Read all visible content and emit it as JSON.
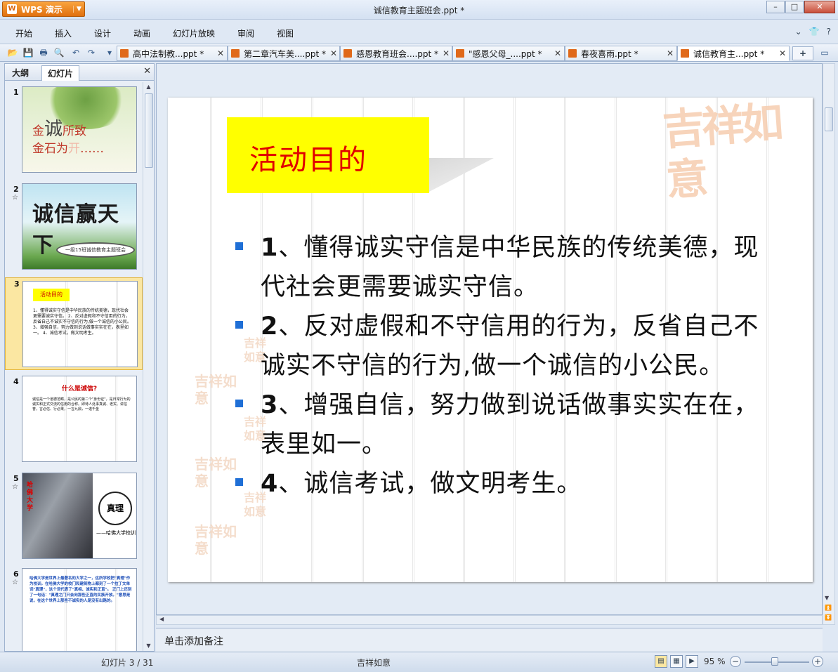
{
  "app": {
    "button_label": "WPS 演示",
    "logo_glyph": "W",
    "document_title": "诚信教育主题班会.ppt *"
  },
  "window_controls": {
    "minimize": "–",
    "maximize": "□",
    "close": "✕"
  },
  "menu": {
    "items": [
      "开始",
      "插入",
      "设计",
      "动画",
      "幻灯片放映",
      "审阅",
      "视图"
    ],
    "right_icons": [
      "⌄",
      "👕",
      "?"
    ]
  },
  "toolbar": {
    "icons": [
      "open-icon",
      "save-icon",
      "print-icon",
      "print-preview-icon",
      "undo-icon",
      "redo-icon",
      "customize-icon"
    ],
    "tabs": [
      {
        "label": "高中法制教...ppt *"
      },
      {
        "label": "第二章汽车美....ppt *"
      },
      {
        "label": "感恩教育班会....ppt *"
      },
      {
        "label": "\"感恩父母_....ppt *"
      },
      {
        "label": "春夜喜雨.ppt *"
      },
      {
        "label": "诚信教育主...ppt *",
        "active": true
      }
    ],
    "tab_close": "✕",
    "add_tab": "+"
  },
  "left_panel": {
    "tabs": [
      "大纲",
      "幻灯片"
    ],
    "active_tab": "幻灯片",
    "close": "✕",
    "thumbnails": [
      {
        "num": "1",
        "star": "",
        "text_a": "金",
        "text_b": "诚",
        "text_c": "所致",
        "text_d": "金石为",
        "text_e": "开",
        "text_f": "……"
      },
      {
        "num": "2",
        "star": "☆",
        "calligraphy": "诚信赢天下",
        "oval": "一级15班诚信教育主题班会"
      },
      {
        "num": "3",
        "star": "",
        "title": "活动目的",
        "body": "1、懂得诚实守信是中华民族的传统美德，现代社会更需要诚实守信。 2、反对虚假和不守信用的行为，反省自己不诚实不守信的行为,做一个诚信的小公民。 3、增强自信，努力做到说话做事实实在在，表里如一。 4、诚信考试，做文明考生。"
      },
      {
        "num": "4",
        "star": "",
        "title": "什么是诚信?",
        "body": "诚信是一个道德范畴，是公民的第二个\"身份证\"，是日常行为的诚实和正式交流的信用的合称。即待人处事真诚、老实、讲信誉，言必信、行必果，一言九鼎，一诺千金"
      },
      {
        "num": "5",
        "star": "☆",
        "red": "哈佛大学",
        "circle": "真理",
        "sub": "——哈佛大学校训"
      },
      {
        "num": "6",
        "star": "☆",
        "body": "哈佛大学是世界上最著名的大学之一，这所学校把\"真理\"作为校训。在哈佛大学的校门和建筑物上都刻了一个拉丁文单词\"真理\"，这个词代表了\"真相、诚实和正直\"。 正门上还刻了一句话：\"真理之门只会向那些正直的民族开放。\"意思是说，在这个世界上那些不诚实的人是没有出路的。"
      }
    ]
  },
  "slide": {
    "title": "活动目的",
    "seal_text": "吉祥如意",
    "bullets": [
      {
        "num": "1",
        "text": "、懂得诚实守信是中华民族的传统美德，现代社会更需要诚实守信。"
      },
      {
        "num": "2",
        "text": "、反对虚假和不守信用的行为，反省自己不诚实不守信的行为,做一个诚信的小公民。"
      },
      {
        "num": "3",
        "text": "、增强自信，努力做到说话做事实实在在，表里如一。"
      },
      {
        "num": "4",
        "text": "、诚信考试，做文明考生。"
      }
    ],
    "accent_title_bg": "#ffff00",
    "accent_title_color": "#e00000",
    "bullet_color": "#1f6fd6"
  },
  "notes": {
    "placeholder": "单击添加备注"
  },
  "status": {
    "slide_counter": "幻灯片 3 / 31",
    "theme": "吉祥如意",
    "zoom": "95 %",
    "zoom_level_percent": 95,
    "zoom_minus": "−",
    "zoom_plus": "+"
  }
}
